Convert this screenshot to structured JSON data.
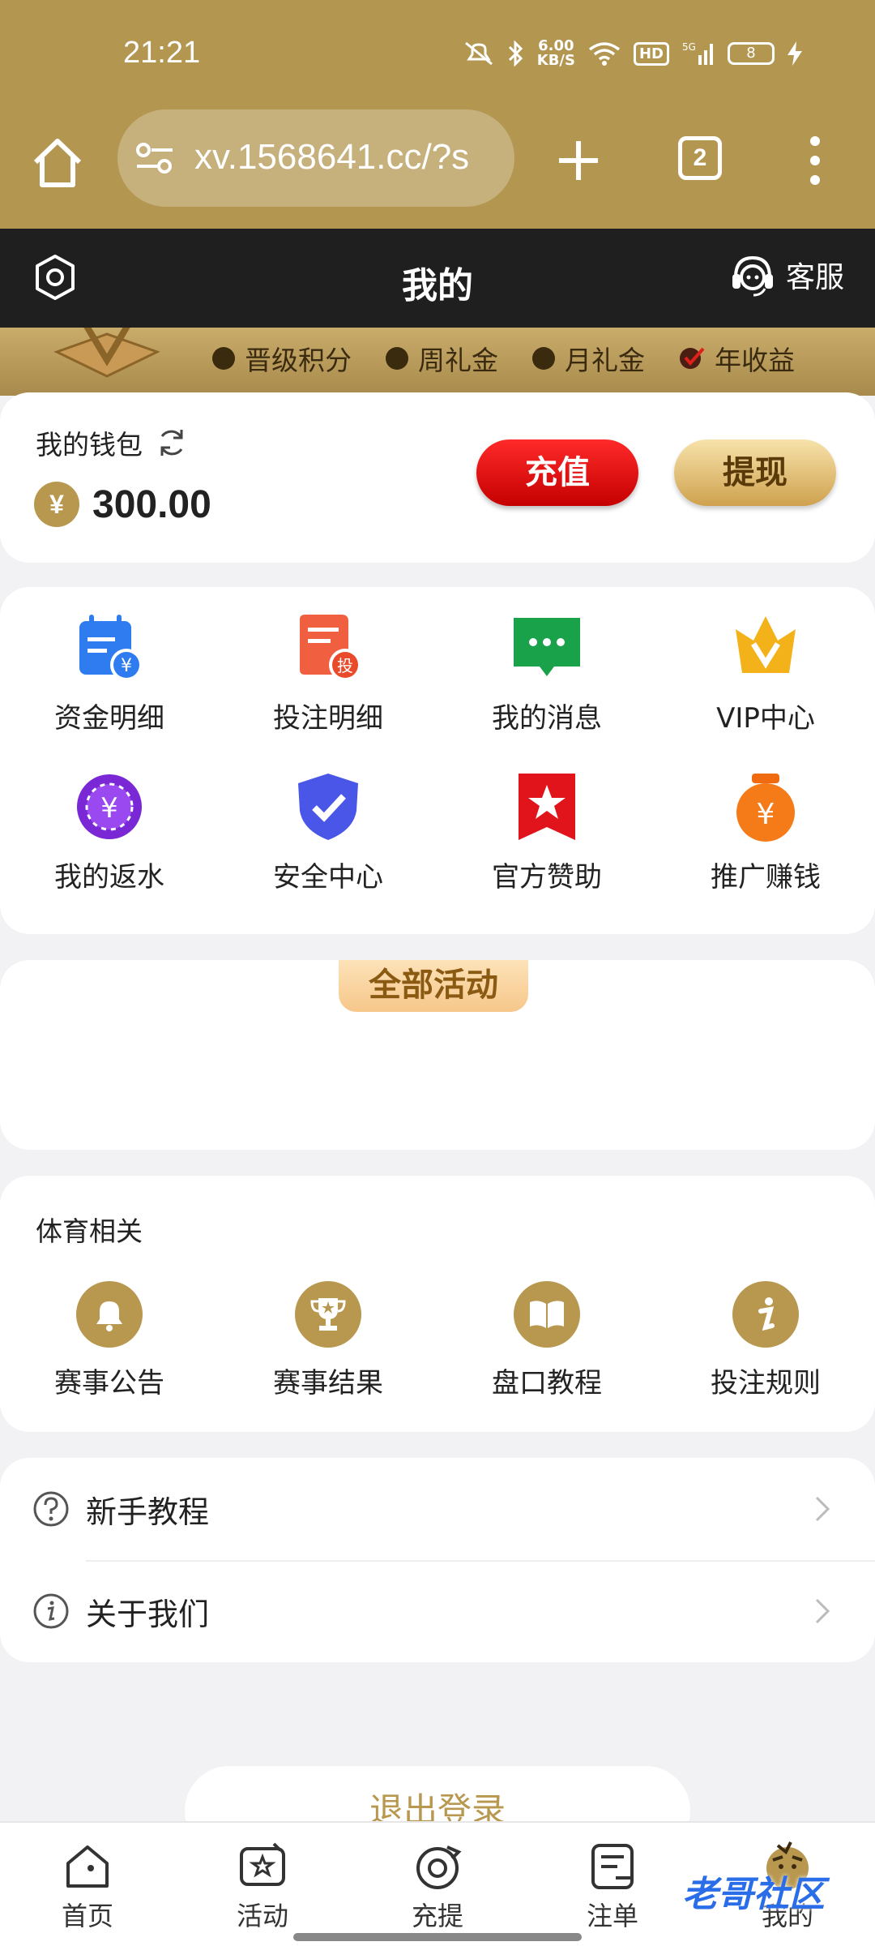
{
  "status_bar": {
    "time": "21:21",
    "net_speed": "6.00",
    "net_unit": "KB/S",
    "hd": "HD",
    "signal": "5G",
    "battery": "8"
  },
  "browser": {
    "url": "xv.1568641.cc/?s",
    "tab_count": "2"
  },
  "header": {
    "title": "我的",
    "service_label": "客服"
  },
  "vip_strip": {
    "items": [
      "晋级积分",
      "周礼金",
      "月礼金",
      "年收益"
    ]
  },
  "wallet": {
    "label": "我的钱包",
    "currency_symbol": "¥",
    "balance": "300.00",
    "recharge": "充值",
    "withdraw": "提现"
  },
  "menu": {
    "items": [
      {
        "label": "资金明细",
        "icon": "funds-detail-icon"
      },
      {
        "label": "投注明细",
        "icon": "bet-detail-icon"
      },
      {
        "label": "我的消息",
        "icon": "message-icon"
      },
      {
        "label": "VIP中心",
        "icon": "vip-icon"
      },
      {
        "label": "我的返水",
        "icon": "rebate-icon"
      },
      {
        "label": "安全中心",
        "icon": "shield-icon"
      },
      {
        "label": "官方赞助",
        "icon": "star-flag-icon"
      },
      {
        "label": "推广赚钱",
        "icon": "promo-money-icon"
      }
    ]
  },
  "activities": {
    "tab_label": "全部活动"
  },
  "sports": {
    "title": "体育相关",
    "items": [
      {
        "label": "赛事公告",
        "icon": "bell-icon"
      },
      {
        "label": "赛事结果",
        "icon": "trophy-icon"
      },
      {
        "label": "盘口教程",
        "icon": "book-icon"
      },
      {
        "label": "投注规则",
        "icon": "info-icon"
      }
    ]
  },
  "list": {
    "items": [
      {
        "label": "新手教程",
        "icon": "question-icon"
      },
      {
        "label": "关于我们",
        "icon": "info-circle-icon"
      }
    ]
  },
  "logout": {
    "label": "退出登录"
  },
  "bottom_nav": {
    "items": [
      {
        "label": "首页",
        "icon": "home-icon"
      },
      {
        "label": "活动",
        "icon": "activity-icon"
      },
      {
        "label": "充提",
        "icon": "deposit-icon"
      },
      {
        "label": "注单",
        "icon": "orders-icon"
      },
      {
        "label": "我的",
        "icon": "profile-icon"
      }
    ]
  },
  "watermark": "老哥社区",
  "colors": {
    "gold": "#b8974f",
    "header_dark": "#1f1f1f",
    "red": "#e00000"
  }
}
